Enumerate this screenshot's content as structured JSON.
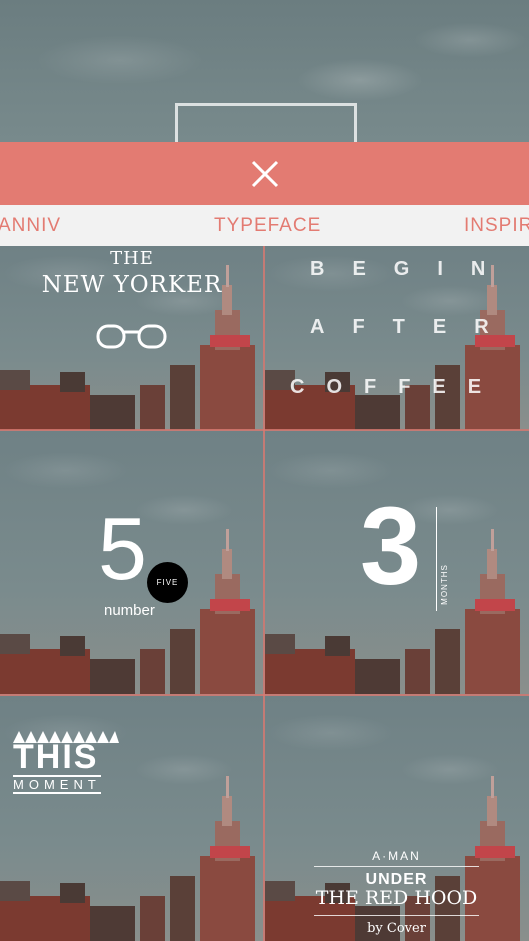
{
  "header": {
    "close_icon": "close-icon",
    "accent_color": "#e37b72"
  },
  "tabs": [
    {
      "label": "ANNIV"
    },
    {
      "label": "TYPEFACE"
    },
    {
      "label": "INSPIR"
    }
  ],
  "templates": {
    "new_yorker": {
      "line1": "THE",
      "line2": "NEW YORKER",
      "icon": "glasses-icon"
    },
    "coffee": {
      "line1": "BEGIN",
      "line2": "AFTER",
      "line3": "COFFEE"
    },
    "five": {
      "number": "5",
      "word": "number",
      "badge": "FIVE"
    },
    "three": {
      "number": "3",
      "unit": "MONTHS"
    },
    "moment": {
      "line1": "THIS",
      "line2": "MOMENT"
    },
    "red_hood": {
      "line1": "A·MAN",
      "line2": "UNDER",
      "line3": "THE RED HOOD",
      "line4": "by Cover"
    }
  }
}
